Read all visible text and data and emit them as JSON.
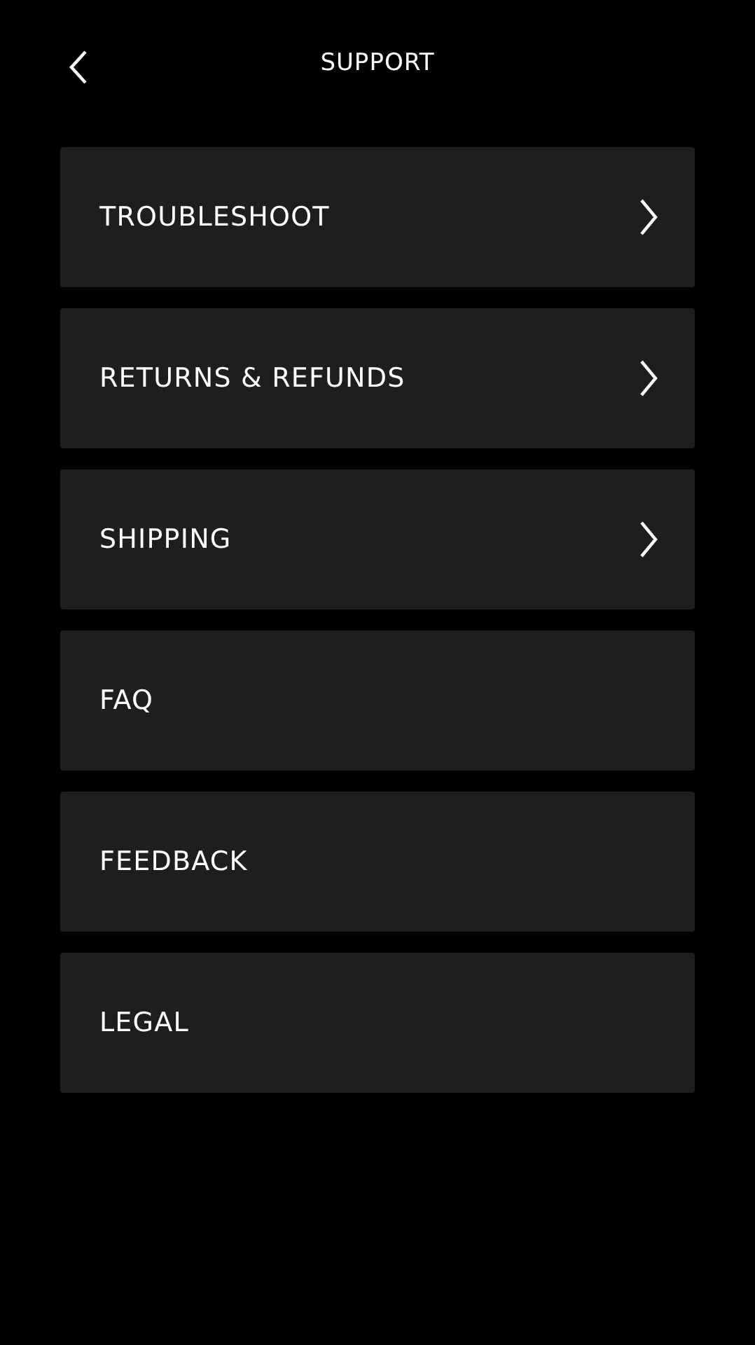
{
  "header": {
    "title": "SUPPORT"
  },
  "items": [
    {
      "label": "TROUBLESHOOT",
      "kind": "submenu"
    },
    {
      "label": "RETURNS & REFUNDS",
      "kind": "submenu"
    },
    {
      "label": "SHIPPING",
      "kind": "submenu"
    },
    {
      "label": "FAQ",
      "kind": "link"
    },
    {
      "label": "FEEDBACK",
      "kind": "link"
    },
    {
      "label": "LEGAL",
      "kind": "link"
    }
  ]
}
